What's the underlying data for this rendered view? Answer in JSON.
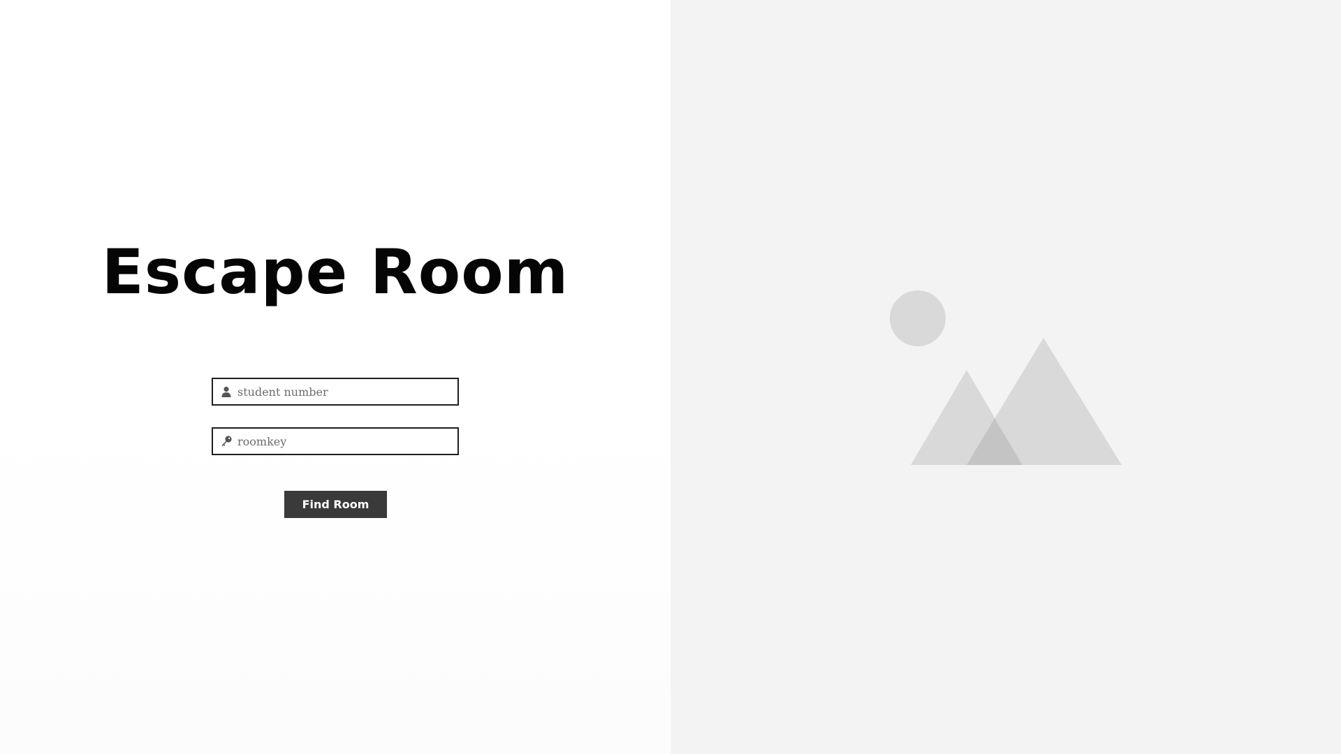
{
  "title": "Escape Room",
  "login_form": {
    "student_number": {
      "placeholder": "student number",
      "value": "",
      "icon": "user-icon"
    },
    "roomkey": {
      "placeholder": "roomkey",
      "value": "",
      "icon": "key-icon"
    },
    "submit_label": "Find Room"
  },
  "image_placeholder": {
    "icon": "image-placeholder-icon",
    "colors": {
      "background": "#f3f3f3",
      "shape": "#d9d9d9",
      "overlap": "#c4c4c4"
    }
  },
  "colors": {
    "button": "#3a3a3a",
    "field_border": "#1e1e1e",
    "title": "#050505"
  }
}
